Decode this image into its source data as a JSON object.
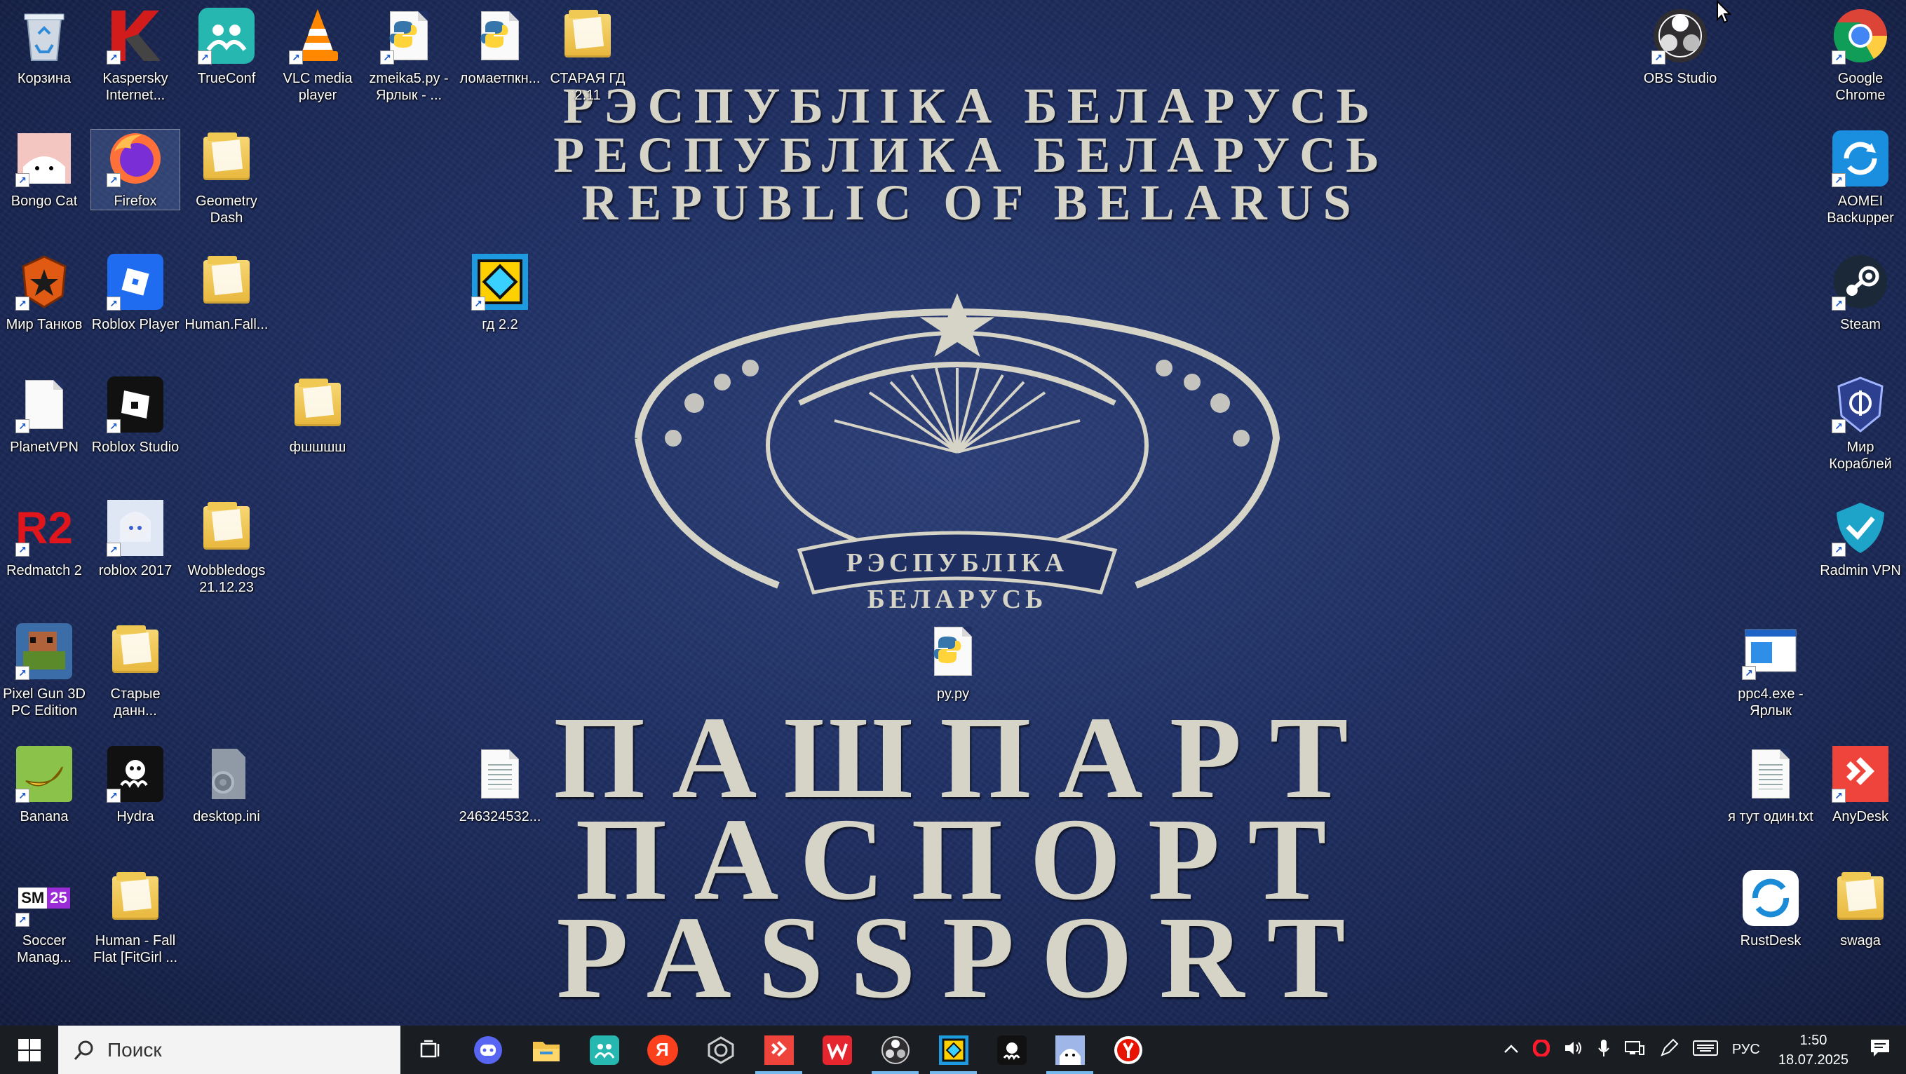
{
  "wallpaper": {
    "line1": "РЭСПУБЛІКА БЕЛАРУСЬ",
    "line2": "РЕСПУБЛИКА БЕЛАРУСЬ",
    "line3": "REPUBLIC OF BELARUS",
    "emblem_band_top": "РЭСПУБЛІКА",
    "emblem_band_bottom": "БЕЛАРУСЬ",
    "big1": "ПАШПАРТ",
    "big2": "ПАСПОРТ",
    "big3": "PASSPORT"
  },
  "desktop_icons": {
    "recycle": "Корзина",
    "kaspersky": "Kaspersky Internet...",
    "trueconf": "TrueConf",
    "vlc": "VLC media player",
    "zmeika": "zmeika5.py - Ярлык - ...",
    "lomaet": "ломаетпкн...",
    "staraya": "СТАРАЯ ГД 2.11",
    "obs": "OBS Studio",
    "chrome": "Google Chrome",
    "bongo": "Bongo Cat",
    "firefox": "Firefox",
    "gd": "Geometry Dash",
    "aomei": "AOMEI Backupper",
    "mirtankov": "Мир Танков",
    "roblox_player": "Roblox Player",
    "humanfall": "Human.Fall...",
    "gd22": "гд 2.2",
    "steam": "Steam",
    "planetvpn": "PlanetVPN",
    "roblox_studio": "Roblox Studio",
    "fshshsh": "фшшшш",
    "mirkorabley": "Мир Кораблей",
    "redmatch": "Redmatch 2",
    "roblox2017": "roblox 2017",
    "wobbledogs": "Wobbledogs 21.12.23",
    "radmin": "Radmin VPN",
    "pixelgun": "Pixel Gun 3D PC Edition",
    "starye": "Старые данн...",
    "pypy": "py.py",
    "ppc4": "ppc4.exe - Ярлык",
    "banana": "Banana",
    "hydra": "Hydra",
    "desktopini": "desktop.ini",
    "num": "246324532...",
    "yatut": "я тут один.txt",
    "anydesk": "AnyDesk",
    "soccer": "Soccer Manag...",
    "humanfall_fitgirl": "Human - Fall Flat [FitGirl ...",
    "rustdesk": "RustDesk",
    "swaga": "swaga"
  },
  "taskbar": {
    "search_placeholder": "Поиск",
    "language": "РУС",
    "time": "1:50",
    "date": "18.07.2025",
    "yandex_letter": "Я",
    "sm_badge": "SM",
    "sm_num": "25",
    "r2": "R2"
  },
  "colors": {
    "wallpaper": "#1f2f62",
    "taskbar": "#1a1d22",
    "accent": "#76b9ed"
  }
}
